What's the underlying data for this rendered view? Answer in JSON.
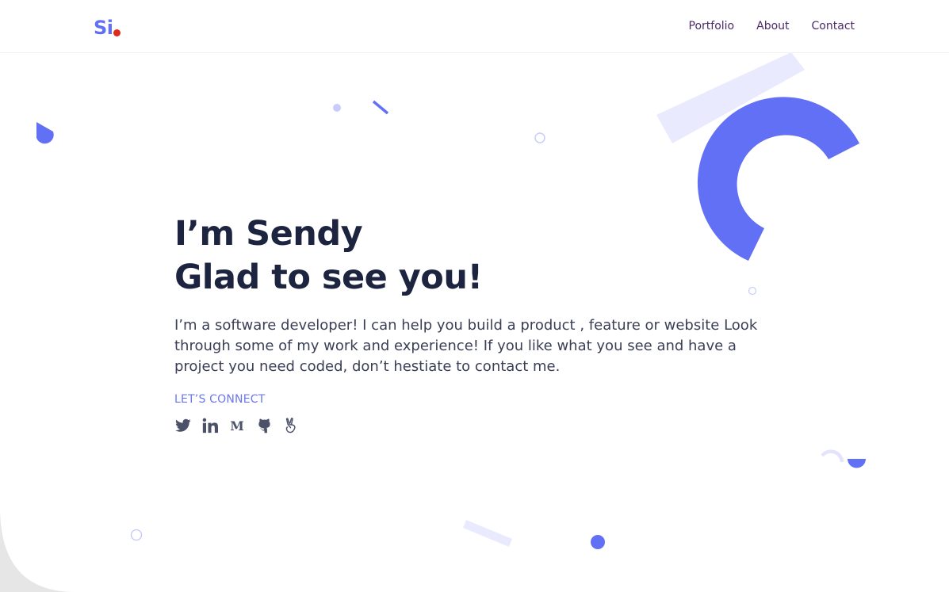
{
  "header": {
    "logo_text": "Si",
    "nav": [
      "Portfolio",
      "About",
      "Contact"
    ]
  },
  "hero": {
    "title_line1": "I’m Sendy",
    "title_line2": "Glad to see you!",
    "description": "I’m a software developer! I can help you build a product , feature or website Look through some of my work and experience! If you like what you see and have a project you need coded, don’t hestiate to contact me.",
    "connect_label": "LET’S CONNECT",
    "socials": [
      "twitter-icon",
      "linkedin-icon",
      "medium-icon",
      "github-icon",
      "angellist-icon"
    ]
  },
  "colors": {
    "accent": "#6270f5",
    "accent_light": "#e9eafd",
    "logo_dot": "#e02a1a",
    "heading": "#1c2440",
    "nav_text": "#4a2a6a",
    "icon": "#4a5168",
    "corner_blob": "#e6e6e6"
  }
}
